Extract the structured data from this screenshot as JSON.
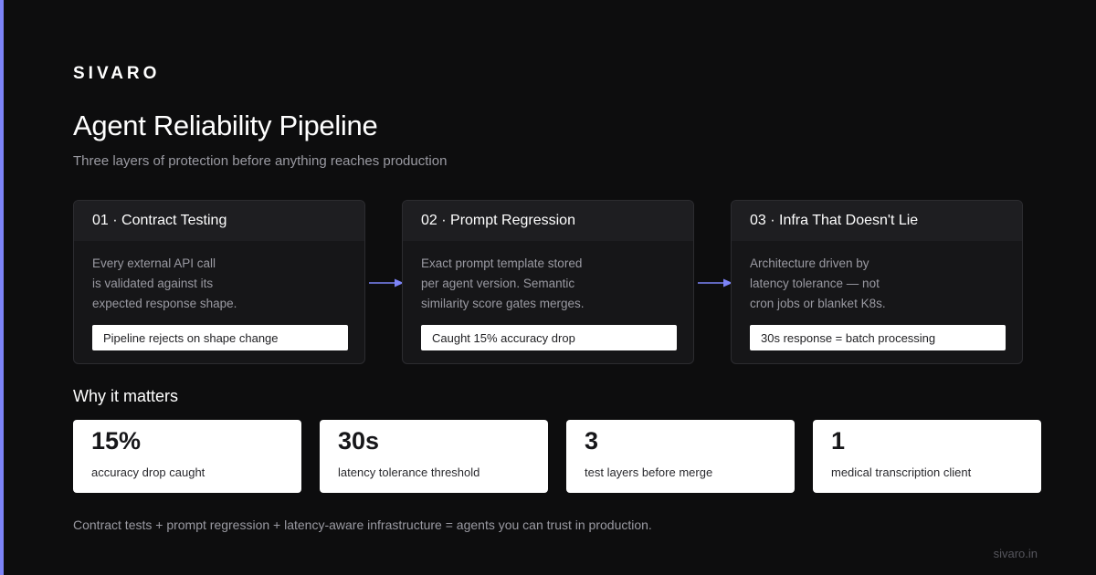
{
  "colors": {
    "background": "#0d0d0e",
    "accent": "#7c83f7",
    "card": "#161618",
    "card_header": "#1e1e21",
    "muted_text": "#9a9aa2",
    "stat_card": "#ffffff"
  },
  "brand": "SIVARO",
  "title": "Agent Reliability Pipeline",
  "subtitle": "Three layers of protection before anything reaches production",
  "stages": [
    {
      "title": "01 · Contract Testing",
      "lines": [
        "Every external API call",
        "is validated against its",
        "expected response shape."
      ],
      "tag": "Pipeline rejects on shape change"
    },
    {
      "title": "02 · Prompt Regression",
      "lines": [
        "Exact prompt template stored",
        "per agent version. Semantic",
        "similarity score gates merges."
      ],
      "tag": "Caught 15% accuracy drop"
    },
    {
      "title": "03 · Infra That Doesn't Lie",
      "lines": [
        "Architecture driven by",
        "latency tolerance — not",
        "cron jobs or blanket K8s."
      ],
      "tag": "30s response = batch processing"
    }
  ],
  "section_title": "Why it matters",
  "stats": [
    {
      "value": "15%",
      "label": "accuracy drop caught"
    },
    {
      "value": "30s",
      "label": "latency tolerance threshold"
    },
    {
      "value": "3",
      "label": "test layers before merge"
    },
    {
      "value": "1",
      "label": "medical transcription client"
    }
  ],
  "footer_note": "Contract tests + prompt regression + latency-aware infrastructure = agents you can trust in production.",
  "site": "sivaro.in"
}
